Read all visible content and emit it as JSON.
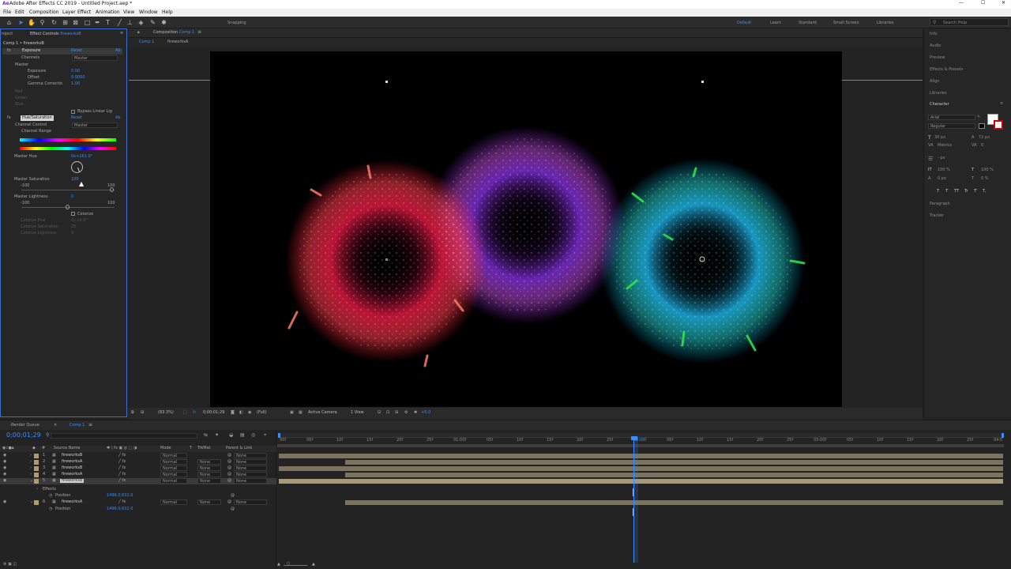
{
  "app": {
    "title": "Adobe After Effects CC 2019 - Untitled Project.aep *"
  },
  "menu": [
    "File",
    "Edit",
    "Composition",
    "Layer",
    "Effect",
    "Animation",
    "View",
    "Window",
    "Help"
  ],
  "toolbar": {
    "snapping_label": "Snapping",
    "workspaces": [
      "Default",
      "Learn",
      "Standard",
      "Small Screen",
      "Libraries"
    ],
    "search_placeholder": "Search Help"
  },
  "effect_controls": {
    "project_tab": "roject",
    "tab_label": "Effect Controls",
    "tab_layer": "fireworksB",
    "breadcrumb": "Comp 1 • fireworksB",
    "exposure": {
      "name": "Exposure",
      "reset": "Reset",
      "about": "Ab",
      "channels_label": "Channels",
      "channels_value": "Master",
      "master_label": "Master",
      "exposure_label": "Exposure",
      "exposure_value": "0.00",
      "offset_label": "Offset",
      "offset_value": "0.0000",
      "gamma_label": "Gamma Correctio",
      "gamma_value": "1.00",
      "red": "Red",
      "green": "Green",
      "blue": "Blue",
      "bypass_label": "Bypass Linear Lig"
    },
    "hue_sat": {
      "name": "Hue/Saturation",
      "reset": "Reset",
      "about": "Ab",
      "channel_control_label": "Channel Control",
      "channel_control_value": "Master",
      "channel_range_label": "Channel Range",
      "master_hue_label": "Master Hue",
      "master_hue_value": "0x+161.0°",
      "master_sat_label": "Master Saturation",
      "master_sat_value": "100",
      "master_sat_min": "-100",
      "master_sat_max": "100",
      "master_light_label": "Master Lightness",
      "master_light_value": "0",
      "master_light_min": "-100",
      "master_light_max": "100",
      "colorize_label": "Colorize",
      "colorize_hue": "Colorize Hue",
      "colorize_sat": "Colorize Saturation",
      "colorize_light": "Colorize Lightness",
      "colorize_hue_value": "0x+0.0°",
      "colorize_sat_value": "25",
      "colorize_light_value": "0"
    }
  },
  "composition": {
    "tab_prefix": "Composition",
    "tab_name": "Comp 1",
    "sub_tabs": [
      "Comp 1",
      "fireworksA"
    ]
  },
  "viewer_footer": {
    "zoom": "(83.3%)",
    "timecode": "0;00;01;29",
    "resolution": "(Full)",
    "camera": "Active Camera",
    "views": "1 View",
    "exposure": "+0.0"
  },
  "right_panels": [
    "Info",
    "Audio",
    "Preview",
    "Effects & Presets",
    "Align",
    "Libraries"
  ],
  "character": {
    "title": "Character",
    "font": "Arial",
    "style": "Regular",
    "size": "30 px",
    "leading": "72 px",
    "kerning": "Metrics",
    "tracking": "0",
    "stroke": "- px",
    "v_scale": "100 %",
    "h_scale": "100 %",
    "baseline": "0 px",
    "tsume": "0 %",
    "styles": [
      "T",
      "T",
      "TT",
      "Tr",
      "T'",
      "T,"
    ],
    "paragraph": "Paragraph",
    "tracker": "Tracker"
  },
  "timeline": {
    "render_queue": "Render Queue",
    "comp_tab": "Comp 1",
    "timecode": "0;00;01;29",
    "columns": {
      "source_name": "Source Name",
      "mode": "Mode",
      "t": "T",
      "trkmat": "TrkMat",
      "parent": "Parent & Link"
    },
    "layers": [
      {
        "num": "1",
        "name": "fireworksB",
        "mode": "Normal",
        "trkmat": "",
        "parent": "None"
      },
      {
        "num": "2",
        "name": "fireworksA",
        "mode": "Normal",
        "trkmat": "None",
        "parent": "None"
      },
      {
        "num": "3",
        "name": "fireworksB",
        "mode": "Normal",
        "trkmat": "None",
        "parent": "None"
      },
      {
        "num": "4",
        "name": "fireworksA",
        "mode": "Normal",
        "trkmat": "None",
        "parent": "None"
      },
      {
        "num": "5",
        "name": "fireworksB",
        "mode": "Normal",
        "trkmat": "None",
        "parent": "None"
      },
      {
        "num": "6",
        "name": "fireworksA",
        "mode": "Normal",
        "trkmat": "None",
        "parent": "None"
      }
    ],
    "effects_label": "Effects",
    "position_label": "Position",
    "position_value_5": "1496.0,632.0",
    "position_value_6": "1496.0,632.0",
    "ruler": [
      "00f",
      "05f",
      "10f",
      "15f",
      "20f",
      "25f",
      "01:00f",
      "05f",
      "10f",
      "15f",
      "20f",
      "25f",
      "02:00f",
      "05f",
      "10f",
      "15f",
      "20f",
      "25f",
      "03:00f",
      "05f",
      "10f",
      "15f",
      "20f",
      "25f",
      "04:0"
    ]
  },
  "colors": {
    "accent": "#2d8ceb",
    "label_tan": "#b19a6e",
    "layer_bar": "#7c735f",
    "panel_bg": "#232323"
  }
}
